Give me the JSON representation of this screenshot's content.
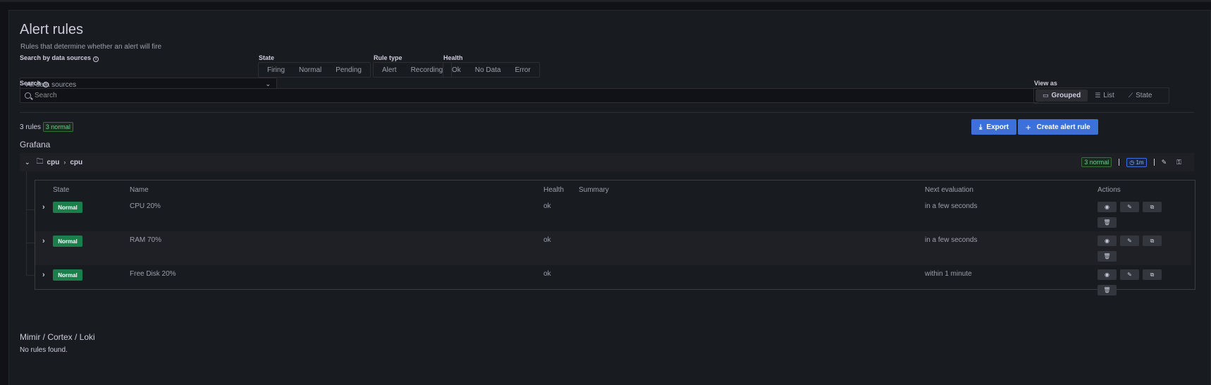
{
  "page": {
    "title": "Alert rules",
    "subtitle": "Rules that determine whether an alert will fire"
  },
  "filters": {
    "datasource_label": "Search by data sources",
    "datasource_value": "All data sources",
    "state_label": "State",
    "state_options": [
      "Firing",
      "Normal",
      "Pending"
    ],
    "ruletype_label": "Rule type",
    "ruletype_options": [
      "Alert",
      "Recording"
    ],
    "health_label": "Health",
    "health_options": [
      "Ok",
      "No Data",
      "Error"
    ],
    "search_label": "Search",
    "search_placeholder": "Search",
    "viewas_label": "View as",
    "viewas_options": [
      "Grouped",
      "List",
      "State"
    ],
    "viewas_selected": "Grouped"
  },
  "summary": {
    "rules_count": "3 rules",
    "normal_badge": "3 normal",
    "export_label": "Export",
    "create_label": "Create alert rule"
  },
  "grafana": {
    "section_title": "Grafana",
    "folder": "cpu",
    "group": "cpu",
    "normal_badge": "3 normal",
    "interval": "1m",
    "columns": [
      "State",
      "Name",
      "Health",
      "Summary",
      "Next evaluation",
      "Actions"
    ],
    "rules": [
      {
        "state": "Normal",
        "name": "CPU 20%",
        "health": "ok",
        "summary": "",
        "next": "in a few seconds"
      },
      {
        "state": "Normal",
        "name": "RAM 70%",
        "health": "ok",
        "summary": "",
        "next": "in a few seconds"
      },
      {
        "state": "Normal",
        "name": "Free Disk 20%",
        "health": "ok",
        "summary": "",
        "next": "within 1 minute"
      }
    ]
  },
  "mimir": {
    "section_title": "Mimir / Cortex / Loki",
    "empty_text": "No rules found."
  },
  "icons": [
    "info-icon",
    "chevron-down-icon",
    "search-icon",
    "folder-icon",
    "list-icon",
    "state-icon",
    "export-icon",
    "plus-icon",
    "clock-icon",
    "edit-icon",
    "permissions-icon",
    "eye-icon",
    "copy-icon",
    "trash-icon",
    "expand-icon"
  ],
  "colors": {
    "primary": "#3d71d9",
    "normal_state": "#1a7f4b",
    "background": "#181b1f"
  }
}
